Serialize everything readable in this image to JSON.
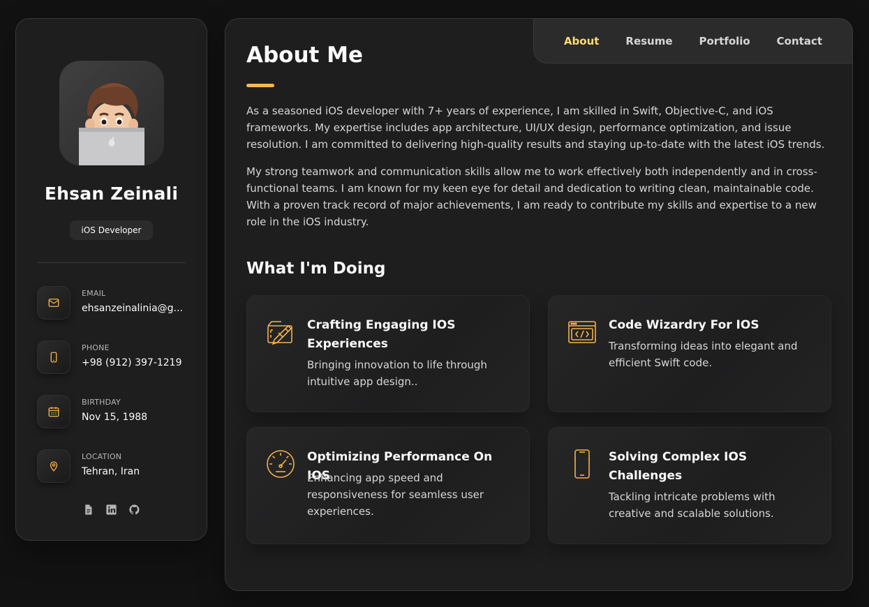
{
  "profile": {
    "name": "Ehsan Zeinali",
    "title": "iOS Developer"
  },
  "contacts": [
    {
      "label": "EMAIL",
      "value": "ehsanzeinalinia@g...",
      "icon": "mail-icon"
    },
    {
      "label": "PHONE",
      "value": "+98 (912) 397-1219",
      "icon": "phone-icon"
    },
    {
      "label": "BIRTHDAY",
      "value": "Nov 15, 1988",
      "icon": "calendar-icon"
    },
    {
      "label": "LOCATION",
      "value": "Tehran, Iran",
      "icon": "location-icon"
    }
  ],
  "socials": [
    "document-icon",
    "linkedin-icon",
    "github-icon"
  ],
  "nav": {
    "items": [
      "About",
      "Resume",
      "Portfolio",
      "Contact"
    ],
    "active": "About"
  },
  "about": {
    "heading": "About Me",
    "paragraphs": [
      "As a seasoned iOS developer with 7+ years of experience, I am skilled in Swift, Objective-C, and iOS frameworks. My expertise includes app architecture, UI/UX design, performance optimization, and issue resolution. I am committed to delivering high-quality results and staying up-to-date with the latest iOS trends.",
      "My strong teamwork and communication skills allow me to work effectively both independently and in cross-functional teams. I am known for my keen eye for detail and dedication to writing clean, maintainable code. With a proven track record of major achievements, I am ready to contribute my skills and expertise to a new role in the iOS industry."
    ]
  },
  "services": {
    "heading": "What I'm Doing",
    "items": [
      {
        "title": "Crafting Engaging IOS Experiences",
        "text": "Bringing innovation to life through intuitive app design..",
        "icon": "design-tools-icon"
      },
      {
        "title": "Code Wizardry For IOS",
        "text": "Transforming ideas into elegant and efficient Swift code.",
        "icon": "code-window-icon"
      },
      {
        "title": "Optimizing Performance On IOS",
        "text": "Enhancing app speed and responsiveness for seamless user experiences.",
        "icon": "speedometer-icon"
      },
      {
        "title": "Solving Complex IOS Challenges",
        "text": "Tackling intricate problems with creative and scalable solutions.",
        "icon": "smartphone-icon"
      }
    ]
  },
  "colors": {
    "accent": "#ffdb70",
    "icon_gold": "#f5b14a",
    "background": "#121212",
    "card": "#1e1e1f"
  }
}
